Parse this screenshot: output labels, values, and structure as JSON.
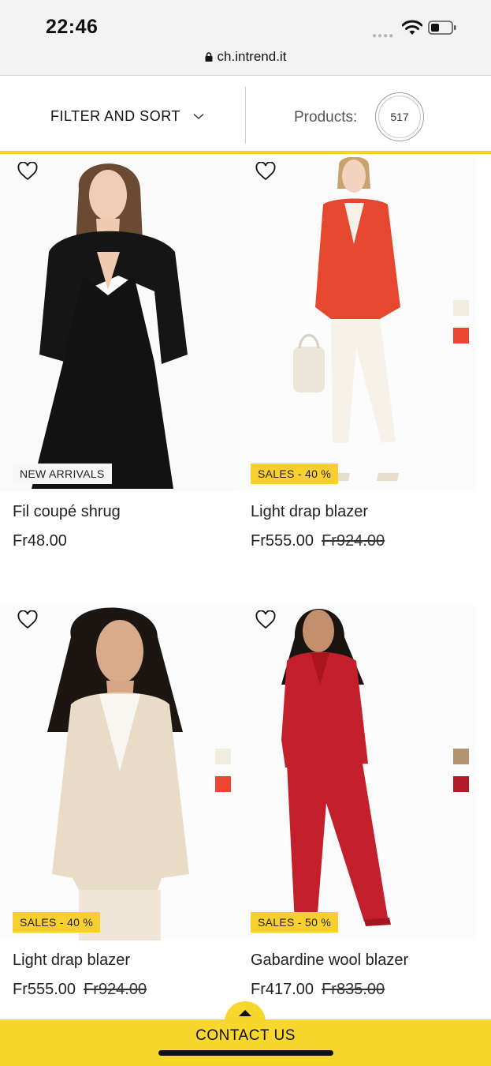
{
  "status_bar": {
    "time": "22:46",
    "url": "ch.intrend.it"
  },
  "toolbar": {
    "filter_label": "FILTER AND SORT",
    "products_label": "Products:",
    "products_count": "517"
  },
  "products": [
    {
      "name": "Fil coupé shrug",
      "price": "Fr48.00",
      "old_price": "",
      "badge": "NEW ARRIVALS",
      "badge_type": "new",
      "swatches": []
    },
    {
      "name": "Light drap blazer",
      "price": "Fr555.00",
      "old_price": "Fr924.00",
      "badge": "SALES - 40 %",
      "badge_type": "sale",
      "swatches": [
        "#f3ece0",
        "#ea4632"
      ]
    },
    {
      "name": "Light drap blazer",
      "price": "Fr555.00",
      "old_price": "Fr924.00",
      "badge": "SALES - 40 %",
      "badge_type": "sale",
      "swatches": [
        "#f3ece0",
        "#ea4632"
      ]
    },
    {
      "name": "Gabardine wool blazer",
      "price": "Fr417.00",
      "old_price": "Fr835.00",
      "badge": "SALES - 50 %",
      "badge_type": "sale",
      "swatches": [
        "#b39372",
        "#b11a26"
      ]
    }
  ],
  "footer": {
    "contact_label": "CONTACT US"
  },
  "colors": {
    "accent_yellow": "#f7cf2e",
    "black_dress": "#141414",
    "orange_red": "#e5482f",
    "beige": "#e8dcc6",
    "deep_red": "#c41f2c"
  }
}
